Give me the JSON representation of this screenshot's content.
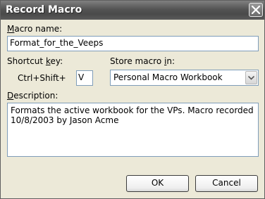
{
  "window": {
    "title": "Record Macro",
    "close_icon": "close-icon"
  },
  "macro_name": {
    "label_accel": "M",
    "label_rest": "acro name:",
    "value": "Format_for_the_Veeps"
  },
  "shortcut": {
    "label_pre": "Shortcut ",
    "label_accel": "k",
    "label_post": "ey:",
    "prefix": "Ctrl+Shift+",
    "value": "V"
  },
  "store": {
    "label_pre": "Store macro ",
    "label_accel": "i",
    "label_post": "n:",
    "selected": "Personal Macro Workbook",
    "arrow_icon": "chevron-down-icon"
  },
  "description": {
    "label_accel": "D",
    "label_rest": "escription:",
    "value": "Formats the active workbook for the VPs. Macro recorded 10/8/2003 by Jason Acme"
  },
  "buttons": {
    "ok": "OK",
    "cancel": "Cancel"
  }
}
